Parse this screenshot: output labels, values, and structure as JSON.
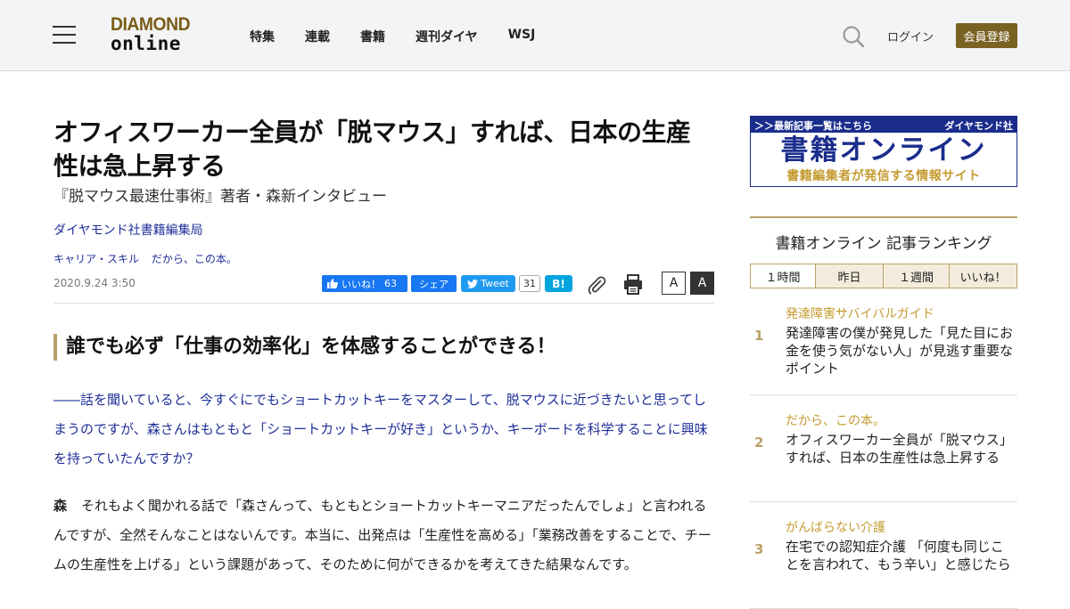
{
  "header": {
    "logo_line1": "DIAMOND",
    "logo_line2": "online",
    "nav": [
      "特集",
      "連載",
      "書籍",
      "週刊ダイヤ",
      "WSJ"
    ],
    "login_label": "ログイン",
    "register_label": "会員登録"
  },
  "article": {
    "title": "オフィスワーカー全員が「脱マウス」すれば、日本の生産性は急上昇する",
    "subtitle": "『脱マウス最速仕事術』著者・森新インタビュー",
    "author": "ダイヤモンド社書籍編集局",
    "tags": [
      "キャリア・スキル",
      "だから、この本。"
    ],
    "date": "2020.9.24 3:50",
    "share": {
      "fb_like_label": "いいね！",
      "fb_like_count": "63",
      "fb_share_label": "シェア",
      "tweet_label": "Tweet",
      "tweet_count": "31",
      "hatena_label": "B!"
    },
    "font_small_label": "A",
    "font_large_label": "A",
    "section_heading": "誰でも必ず「仕事の効率化」を体感することができる！",
    "question": "――話を聞いていると、今すぐにでもショートカットキーをマスターして、脱マウスに近づきたいと思ってしまうのですが、森さんはもともと「ショートカットキーが好き」というか、キーボードを科学することに興味を持っていたんですか？",
    "answer_speaker": "森",
    "answer_text": "それもよく聞かれる話で「森さんって、もともとショートカットキーマニアだったんでしょ」と言われるんですが、全然そんなことはないんです。本当に、出発点は「生産性を高める」「業務改善をすることで、チームの生産性を上げる」という課題があって、そのために何ができるかを考えてきた結果なんです。"
  },
  "sidebar": {
    "banner": {
      "top_left": "＞＞最新記事一覧はこちら",
      "top_right": "ダイヤモンド社",
      "title": "書籍オンライン",
      "subtitle": "書籍編集者が発信する情報サイト"
    },
    "ranking": {
      "title": "書籍オンライン 記事ランキング",
      "tabs": [
        "１時間",
        "昨日",
        "１週間",
        "いいね！"
      ],
      "items": [
        {
          "rank": "1",
          "category": "発達障害サバイバルガイド",
          "title": "発達障害の僕が発見した「見た目にお金を使う気がない人」が見逃す重要なポイント"
        },
        {
          "rank": "2",
          "category": "だから、この本。",
          "title": "オフィスワーカー全員が「脱マウス」すれば、日本の生産性は急上昇する"
        },
        {
          "rank": "3",
          "category": "がんばらない介護",
          "title": "在宅での認知症介護 「何度も同じことを言われて、もう辛い」と感じたら"
        }
      ]
    }
  },
  "colors": {
    "accent_gold": "#b9a16a",
    "link_navy": "#1f2f99",
    "register_bg": "#7a6223"
  }
}
